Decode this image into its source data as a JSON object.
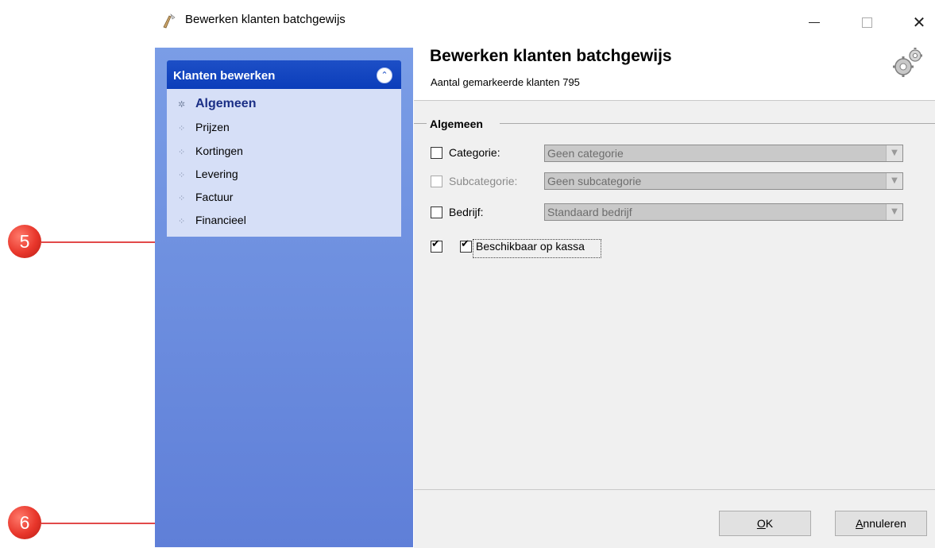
{
  "window": {
    "title": "Bewerken klanten batchgewijs",
    "close_glyph": "✕"
  },
  "nav": {
    "header": "Klanten bewerken",
    "collapse_glyph": "»",
    "items": [
      {
        "label": "Algemeen",
        "active": true
      },
      {
        "label": "Prijzen",
        "active": false
      },
      {
        "label": "Kortingen",
        "active": false
      },
      {
        "label": "Levering",
        "active": false
      },
      {
        "label": "Factuur",
        "active": false
      },
      {
        "label": "Financieel",
        "active": false
      }
    ]
  },
  "content": {
    "title": "Bewerken klanten batchgewijs",
    "subtitle": "Aantal gemarkeerde klanten 795",
    "group_title": "Algemeen",
    "fields": {
      "categorie": {
        "label": "Categorie:",
        "value": "Geen categorie",
        "checked": false,
        "enabled": true
      },
      "subcategorie": {
        "label": "Subcategorie:",
        "value": "Geen subcategorie",
        "checked": false,
        "enabled": false
      },
      "bedrijf": {
        "label": "Bedrijf:",
        "value": "Standaard bedrijf",
        "checked": false,
        "enabled": true
      },
      "kassa": {
        "label": "Beschikbaar op kassa",
        "checked": true,
        "outer_checked": true
      }
    },
    "dropdown_glyph": "▼"
  },
  "footer": {
    "ok_underlined": "O",
    "ok_rest": "K",
    "cancel_underlined": "A",
    "cancel_rest": "nnuleren"
  },
  "annotations": {
    "marker_5": "5",
    "marker_6": "6",
    "color": "#e8362b"
  }
}
